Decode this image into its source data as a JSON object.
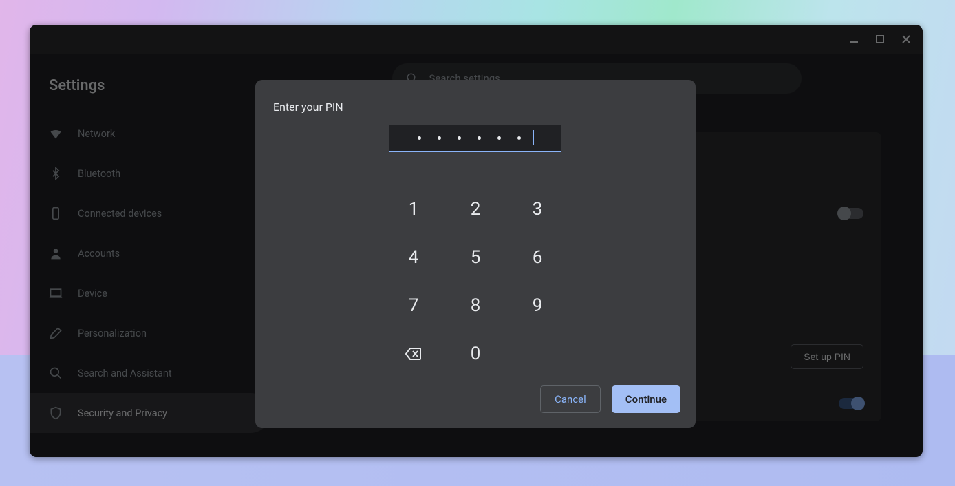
{
  "window": {
    "app_title": "Settings"
  },
  "search": {
    "placeholder": "Search settings"
  },
  "sidebar": {
    "items": [
      {
        "label": "Network",
        "icon": "wifi-icon"
      },
      {
        "label": "Bluetooth",
        "icon": "bluetooth-icon"
      },
      {
        "label": "Connected devices",
        "icon": "phone-icon"
      },
      {
        "label": "Accounts",
        "icon": "person-icon"
      },
      {
        "label": "Device",
        "icon": "laptop-icon"
      },
      {
        "label": "Personalization",
        "icon": "brush-icon"
      },
      {
        "label": "Search and Assistant",
        "icon": "search-icon"
      },
      {
        "label": "Security and Privacy",
        "icon": "shield-icon"
      }
    ],
    "active_index": 7
  },
  "content": {
    "setup_pin_label": "Set up PIN"
  },
  "modal": {
    "title": "Enter your PIN",
    "pin_length_entered": 6,
    "keypad": [
      "1",
      "2",
      "3",
      "4",
      "5",
      "6",
      "7",
      "8",
      "9",
      "",
      "0",
      ""
    ],
    "cancel_label": "Cancel",
    "continue_label": "Continue"
  }
}
